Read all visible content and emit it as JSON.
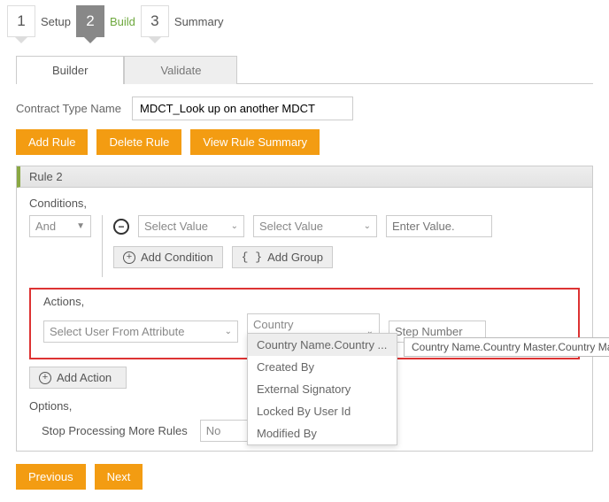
{
  "wizard": {
    "steps": [
      {
        "num": "1",
        "label": "Setup"
      },
      {
        "num": "2",
        "label": "Build"
      },
      {
        "num": "3",
        "label": "Summary"
      }
    ]
  },
  "tabs": {
    "builder": "Builder",
    "validate": "Validate"
  },
  "form": {
    "contract_type_label": "Contract Type Name",
    "contract_type_value": "MDCT_Look up on another MDCT"
  },
  "buttons": {
    "add_rule": "Add Rule",
    "delete_rule": "Delete Rule",
    "view_summary": "View Rule Summary",
    "previous": "Previous",
    "next": "Next",
    "add_condition": "Add Condition",
    "add_group": "Add Group",
    "add_action": "Add Action"
  },
  "rule": {
    "title": "Rule 2",
    "conditions_label": "Conditions,",
    "logic_value": "And",
    "select_value_ph": "Select Value",
    "enter_value_ph": "Enter Value.",
    "actions_label": "Actions,",
    "action_select": "Select User From Attribute",
    "attr_select": "Country Name.Countr",
    "step_ph": "Step Number",
    "options_label": "Options,",
    "stop_label": "Stop Processing More Rules",
    "stop_value": "No"
  },
  "dropdown": {
    "items": [
      "Country Name.Country ...",
      "Created By",
      "External Signatory",
      "Locked By User Id",
      "Modified By"
    ],
    "tooltip": "Country Name.Country Master.Country Manager"
  }
}
